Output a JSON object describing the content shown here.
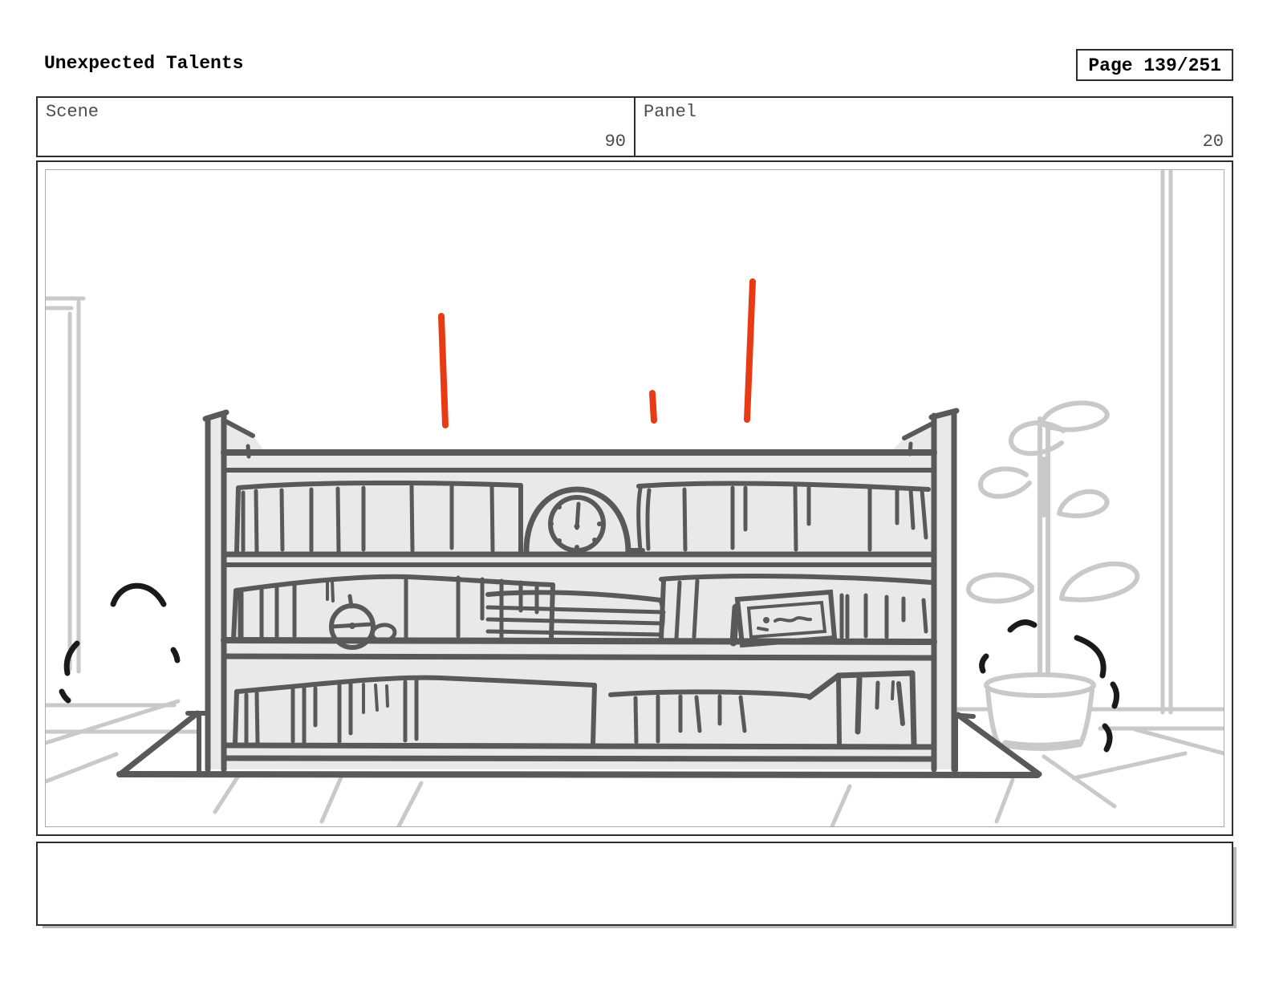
{
  "header": {
    "title": "Unexpected Talents",
    "page_indicator": "Page 139/251"
  },
  "meta": {
    "scene": {
      "label": "Scene",
      "value": "90"
    },
    "panel": {
      "label": "Panel",
      "value": "20"
    }
  },
  "notes": {
    "text": ""
  },
  "sketch": {
    "description": "Hand-drawn storyboard panel: a bookshelf full of books with a mantel clock, pocket watch, pebble and picture frame rises from a trapdoor hole in a tiled floor; light-gray door frame, window wall and potted plant behind; black impact dashes at both sides and red motion lines above the shelf.",
    "colors": {
      "motion_line_red": "#e83a15",
      "sketch_dark_gray": "#595959",
      "sketch_light_gray": "#c9c9c9",
      "impact_mark_black": "#1a1a1a",
      "shelf_fill": "#e9e9e9",
      "box_border": "#2d2d2d",
      "label_gray": "#4d4d4d"
    }
  }
}
